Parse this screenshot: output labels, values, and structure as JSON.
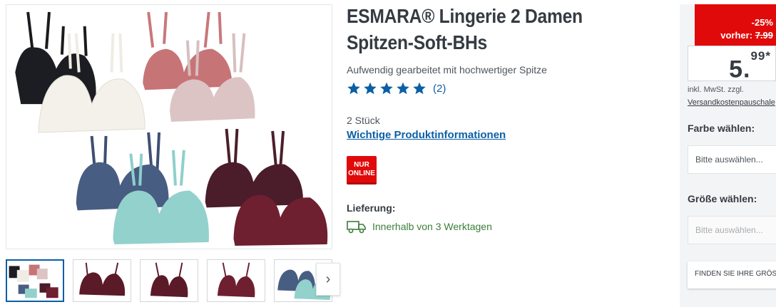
{
  "product": {
    "title_line1": "ESMARA® Lingerie 2 Damen",
    "title_line2": "Spitzen-Soft-BHs",
    "subtitle": "Aufwendig gearbeitet mit hochwertiger Spitze",
    "rating_stars": 5,
    "rating_count": "(2)",
    "quantity": "2 Stück",
    "info_link": "Wichtige Produktinformationen",
    "badge_line1": "NUR",
    "badge_line2": "ONLINE",
    "delivery_label": "Lieferung:",
    "delivery_text": "Innerhalb von 3 Werktagen"
  },
  "gallery": {
    "next_label": "›",
    "thumbnail_count": 5,
    "active_thumbnail": 1
  },
  "buybox": {
    "discount": "-25%",
    "previous_prefix": "vorher:",
    "previous_price": "7.99",
    "price_main": "5.",
    "price_cents": "99*",
    "vat_note": "inkl. MwSt. zzgl.",
    "shipping_link": "Versandkostenpauschale",
    "color_label": "Farbe wählen:",
    "color_placeholder": "Bitte auswählen...",
    "size_label": "Größe wählen:",
    "size_placeholder": "Bitte auswählen...",
    "find_size_label": "FINDEN SIE IHRE GRÖSSE"
  },
  "colors": {
    "brand_red": "#e10a0a",
    "link_blue": "#0b5fa5",
    "delivery_green": "#3c7d3a"
  }
}
